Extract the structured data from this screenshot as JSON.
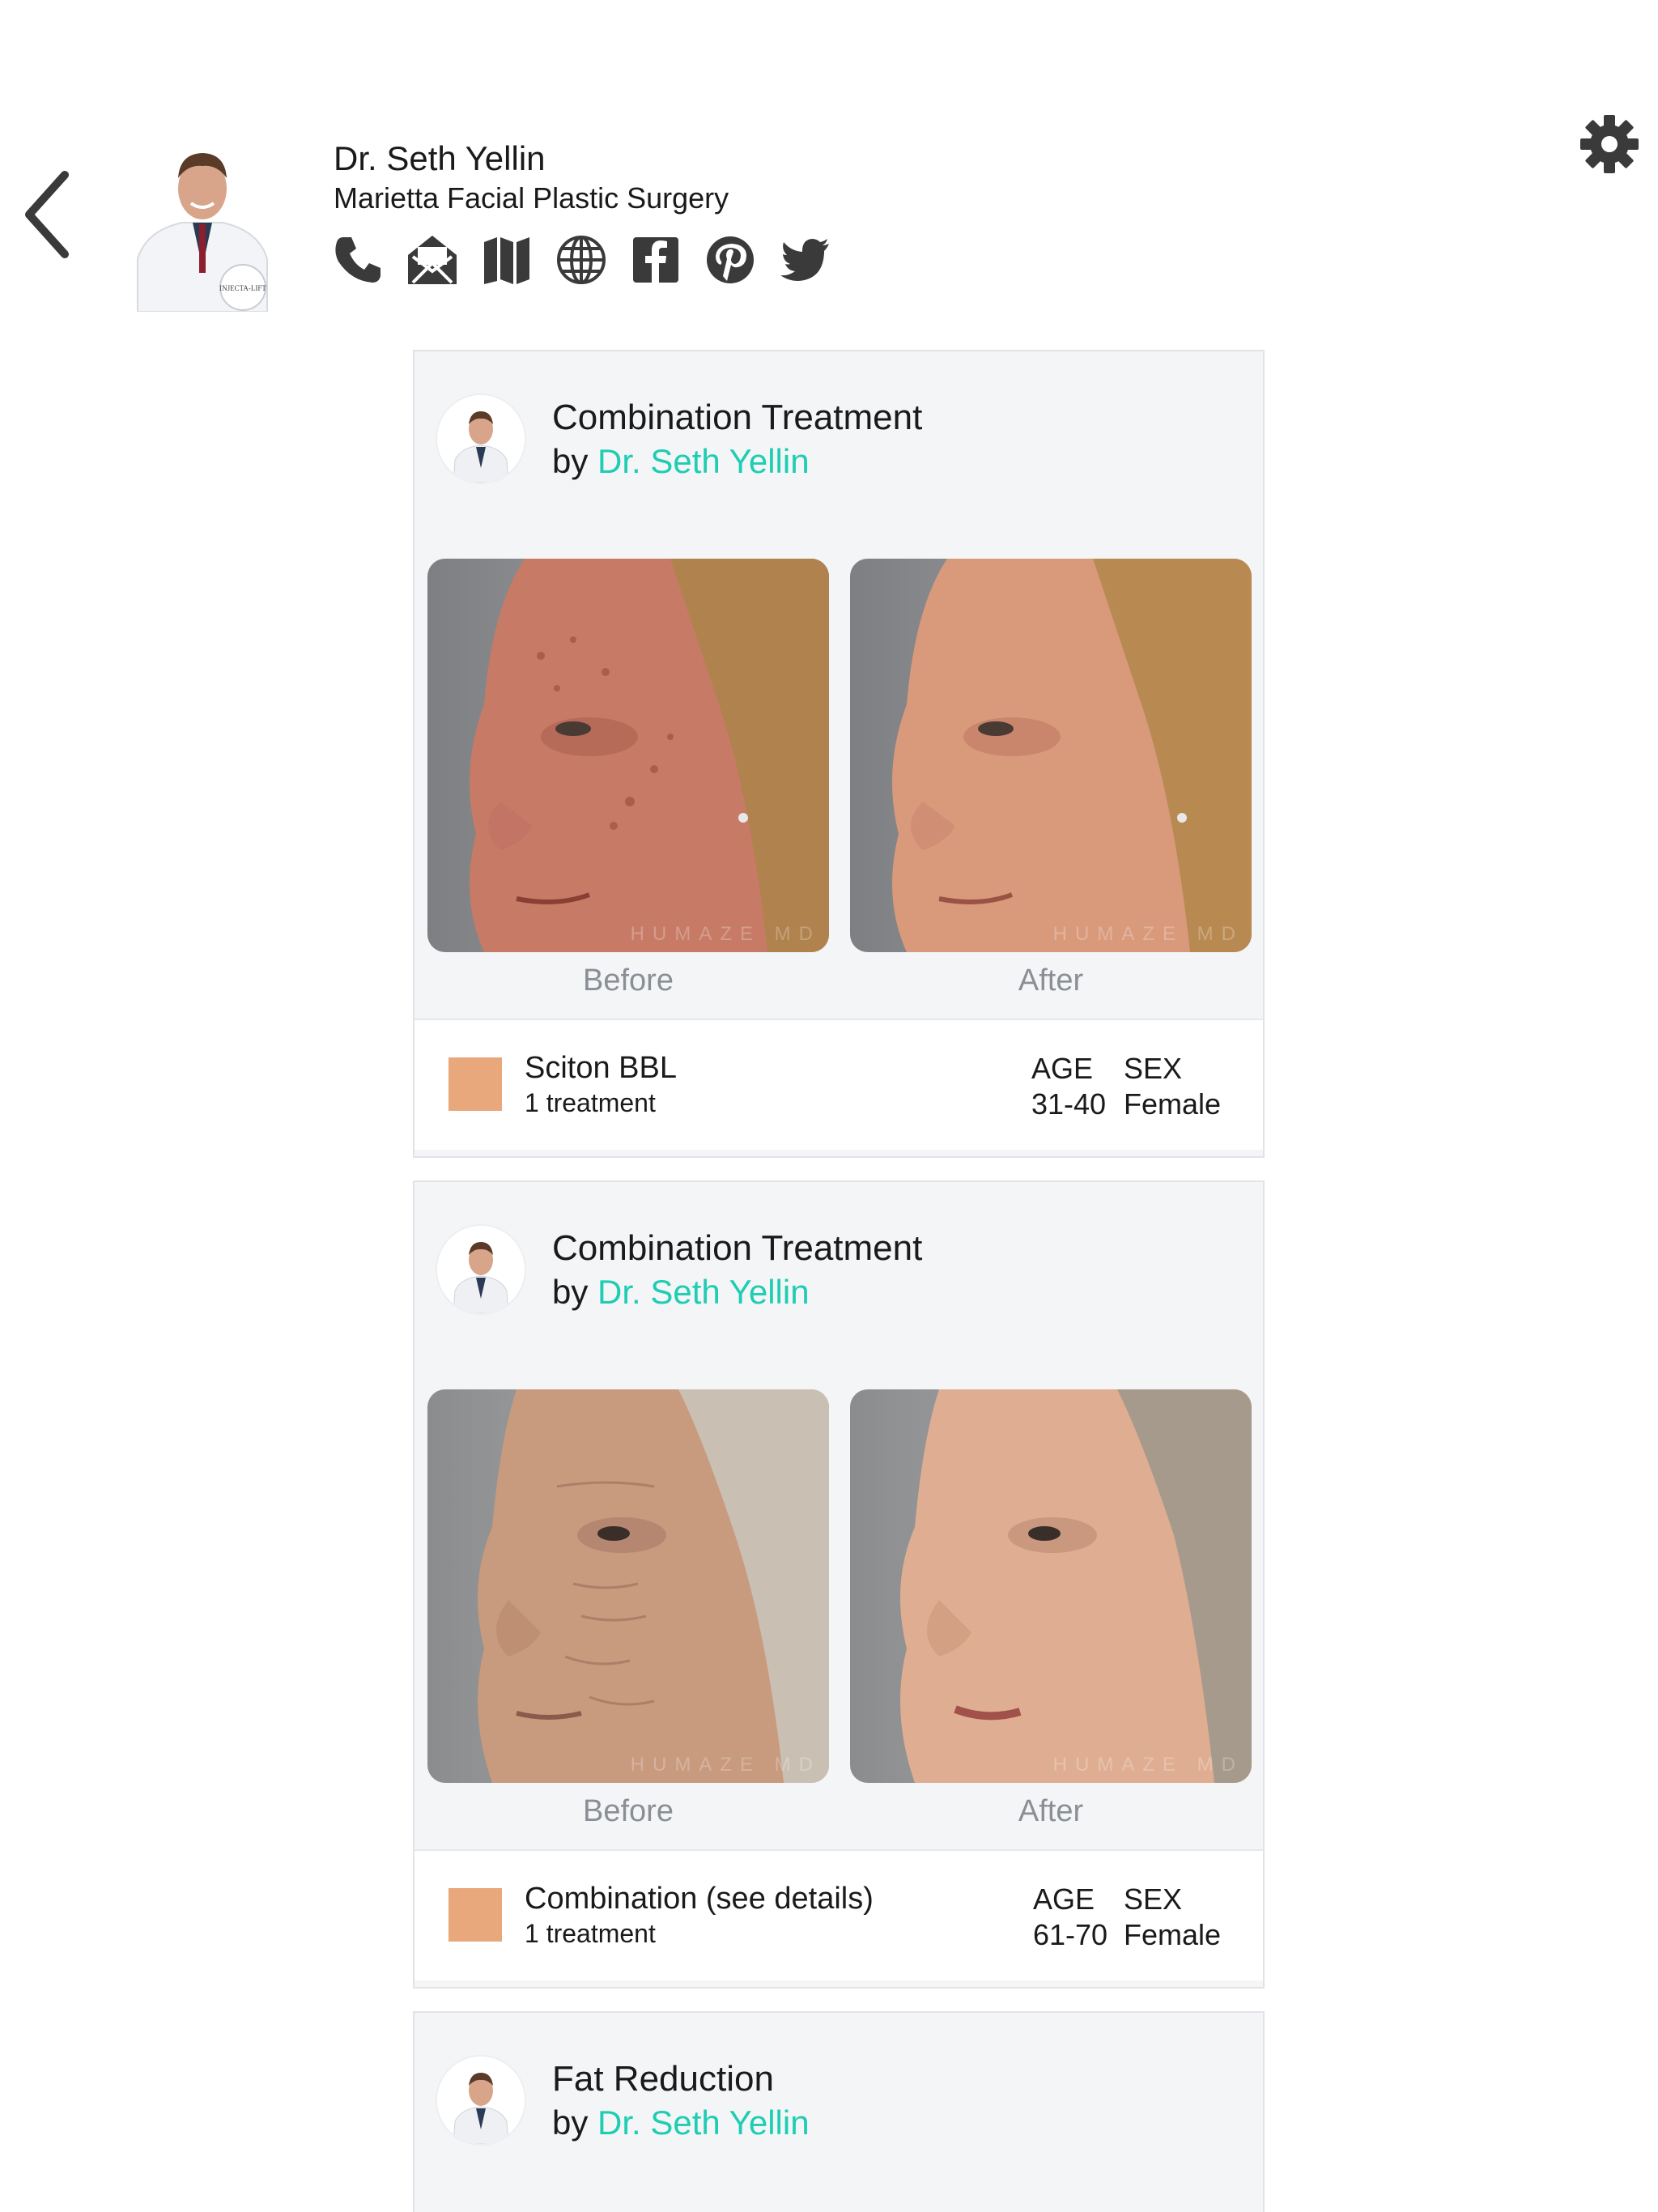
{
  "header": {
    "doctor_name": "Dr. Seth Yellin",
    "practice": "Marietta Facial Plastic Surgery",
    "contact_icons": [
      "phone-icon",
      "email-icon",
      "map-icon",
      "website-icon",
      "facebook-icon",
      "pinterest-icon",
      "twitter-icon"
    ],
    "avatar_badge": "INJECTA-LIFT"
  },
  "theme": {
    "link_color": "#1ecdb2",
    "swatch_color": "#e8a87c",
    "card_bg": "#f4f5f7"
  },
  "cards": [
    {
      "title": "Combination Treatment",
      "by": "by",
      "author": "Dr. Seth Yellin",
      "before_label": "Before",
      "after_label": "After",
      "watermark": "HUMAZE MD",
      "treatment": "Sciton BBL",
      "treatment_count": "1 treatment",
      "age_label": "AGE",
      "age_value": "31-40",
      "sex_label": "SEX",
      "sex_value": "Female"
    },
    {
      "title": "Combination Treatment",
      "by": "by",
      "author": "Dr. Seth Yellin",
      "before_label": "Before",
      "after_label": "After",
      "watermark": "HUMAZE MD",
      "treatment": "Combination (see details)",
      "treatment_count": "1 treatment",
      "age_label": "AGE",
      "age_value": "61-70",
      "sex_label": "SEX",
      "sex_value": "Female"
    },
    {
      "title": "Fat Reduction",
      "by": "by",
      "author": "Dr. Seth Yellin"
    }
  ]
}
